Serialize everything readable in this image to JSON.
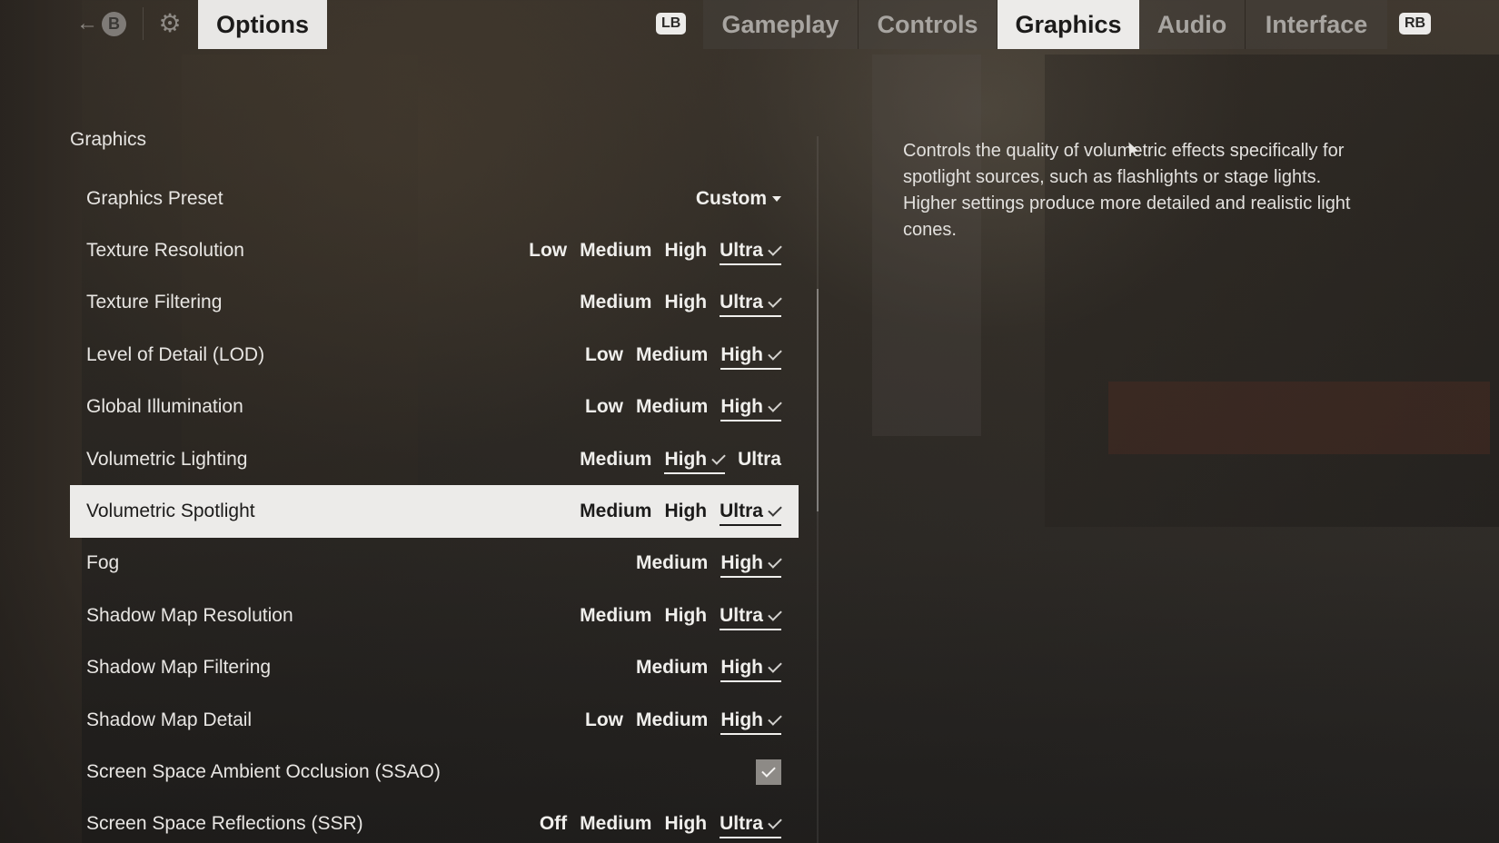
{
  "header": {
    "title": "Options",
    "back_key": "B",
    "left_bumper": "LB",
    "right_bumper": "RB",
    "tabs": [
      {
        "label": "Gameplay",
        "active": false
      },
      {
        "label": "Controls",
        "active": false
      },
      {
        "label": "Graphics",
        "active": true
      },
      {
        "label": "Audio",
        "active": false
      },
      {
        "label": "Interface",
        "active": false
      }
    ]
  },
  "section": {
    "title": "Graphics"
  },
  "settings": [
    {
      "label": "Graphics Preset",
      "type": "dropdown",
      "value": "Custom"
    },
    {
      "label": "Texture Resolution",
      "type": "choice",
      "options": [
        "Low",
        "Medium",
        "High",
        "Ultra"
      ],
      "selected": "Ultra"
    },
    {
      "label": "Texture Filtering",
      "type": "choice",
      "options": [
        "Medium",
        "High",
        "Ultra"
      ],
      "selected": "Ultra"
    },
    {
      "label": "Level of Detail (LOD)",
      "type": "choice",
      "options": [
        "Low",
        "Medium",
        "High"
      ],
      "selected": "High"
    },
    {
      "label": "Global Illumination",
      "type": "choice",
      "options": [
        "Low",
        "Medium",
        "High"
      ],
      "selected": "High"
    },
    {
      "label": "Volumetric Lighting",
      "type": "choice",
      "options": [
        "Medium",
        "High",
        "Ultra"
      ],
      "selected": "High"
    },
    {
      "label": "Volumetric Spotlight",
      "type": "choice",
      "options": [
        "Medium",
        "High",
        "Ultra"
      ],
      "selected": "Ultra",
      "focused": true
    },
    {
      "label": "Fog",
      "type": "choice",
      "options": [
        "Medium",
        "High"
      ],
      "selected": "High"
    },
    {
      "label": "Shadow Map Resolution",
      "type": "choice",
      "options": [
        "Medium",
        "High",
        "Ultra"
      ],
      "selected": "Ultra"
    },
    {
      "label": "Shadow Map Filtering",
      "type": "choice",
      "options": [
        "Medium",
        "High"
      ],
      "selected": "High"
    },
    {
      "label": "Shadow Map Detail",
      "type": "choice",
      "options": [
        "Low",
        "Medium",
        "High"
      ],
      "selected": "High"
    },
    {
      "label": "Screen Space Ambient Occlusion (SSAO)",
      "type": "checkbox",
      "checked": true
    },
    {
      "label": "Screen Space Reflections (SSR)",
      "type": "choice",
      "options": [
        "Off",
        "Medium",
        "High",
        "Ultra"
      ],
      "selected": "Ultra"
    }
  ],
  "description": "Controls the quality of volumetric effects specifically for spotlight sources, such as flashlights or stage lights. Higher settings produce more detailed and realistic light cones.",
  "icons": {
    "back": "back-arrow-icon",
    "settings": "gear-icon",
    "dropdown": "chevron-down-icon",
    "selected_mark": "checkmark-icon"
  },
  "colors": {
    "panel_light": "#ecebe9",
    "text_dark": "#1c1b1a",
    "text_light": "#f0efec",
    "tab_inactive": "#a8a5a1",
    "checkbox_bg": "#8d8a86"
  }
}
